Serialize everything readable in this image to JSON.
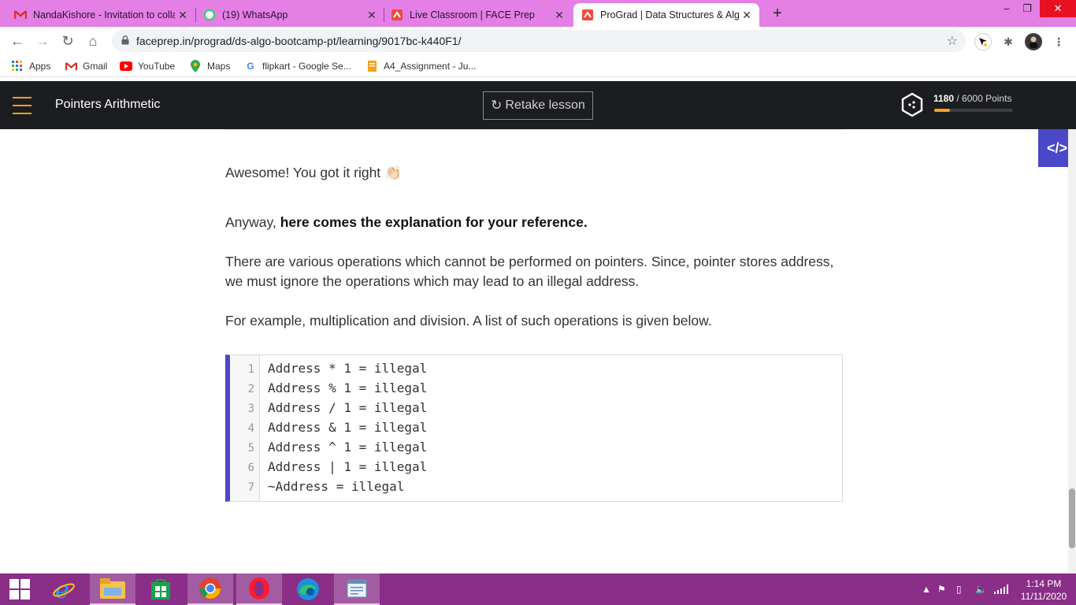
{
  "browser": {
    "tabs": [
      {
        "title": "NandaKishore - Invitation to colla",
        "icon": "gmail-icon",
        "active": false
      },
      {
        "title": "(19) WhatsApp",
        "icon": "whatsapp-icon",
        "badge": "19",
        "active": false
      },
      {
        "title": "Live Classroom | FACE Prep",
        "icon": "faceprep-icon",
        "active": false
      },
      {
        "title": "ProGrad | Data Structures & Algo",
        "icon": "faceprep-icon",
        "active": true
      }
    ],
    "url": "faceprep.in/prograd/ds-algo-bootcamp-pt/learning/9017bc-k440F1/",
    "bookmarks": [
      {
        "label": "Apps",
        "icon": "apps-grid-icon"
      },
      {
        "label": "Gmail",
        "icon": "gmail-icon"
      },
      {
        "label": "YouTube",
        "icon": "youtube-icon"
      },
      {
        "label": "Maps",
        "icon": "maps-pin-icon"
      },
      {
        "label": "flipkart - Google Se...",
        "icon": "google-icon"
      },
      {
        "label": "A4_Assignment - Ju...",
        "icon": "notebook-icon"
      }
    ],
    "accent": "#e47fe6"
  },
  "header": {
    "title": "Pointers Arithmetic",
    "retake_label": "Retake lesson",
    "points_current": "1180",
    "points_total": "/ 6000 Points",
    "points_fraction": 0.197
  },
  "lesson": {
    "success": "Awesome! You got it right 👏🏻",
    "explain_prefix": "Anyway, ",
    "explain_bold": "here comes the explanation for your reference.",
    "para1": "There are various operations which cannot be performed on pointers. Since, pointer stores address, we must ignore the operations which may lead to an illegal address.",
    "para2": "For example, multiplication and division. A list of such operations is given below.",
    "code_lines": [
      "Address * 1 = illegal",
      "Address % 1 = illegal",
      "Address / 1 = illegal",
      "Address & 1 = illegal",
      "Address ^ 1 = illegal",
      "Address | 1 = illegal",
      "~Address = illegal"
    ],
    "line_numbers": [
      "1",
      "2",
      "3",
      "4",
      "5",
      "6",
      "7"
    ],
    "accent": "#4a48c6"
  },
  "taskbar": {
    "time": "1:14 PM",
    "date": "11/11/2020",
    "color": "#8a2e88"
  }
}
